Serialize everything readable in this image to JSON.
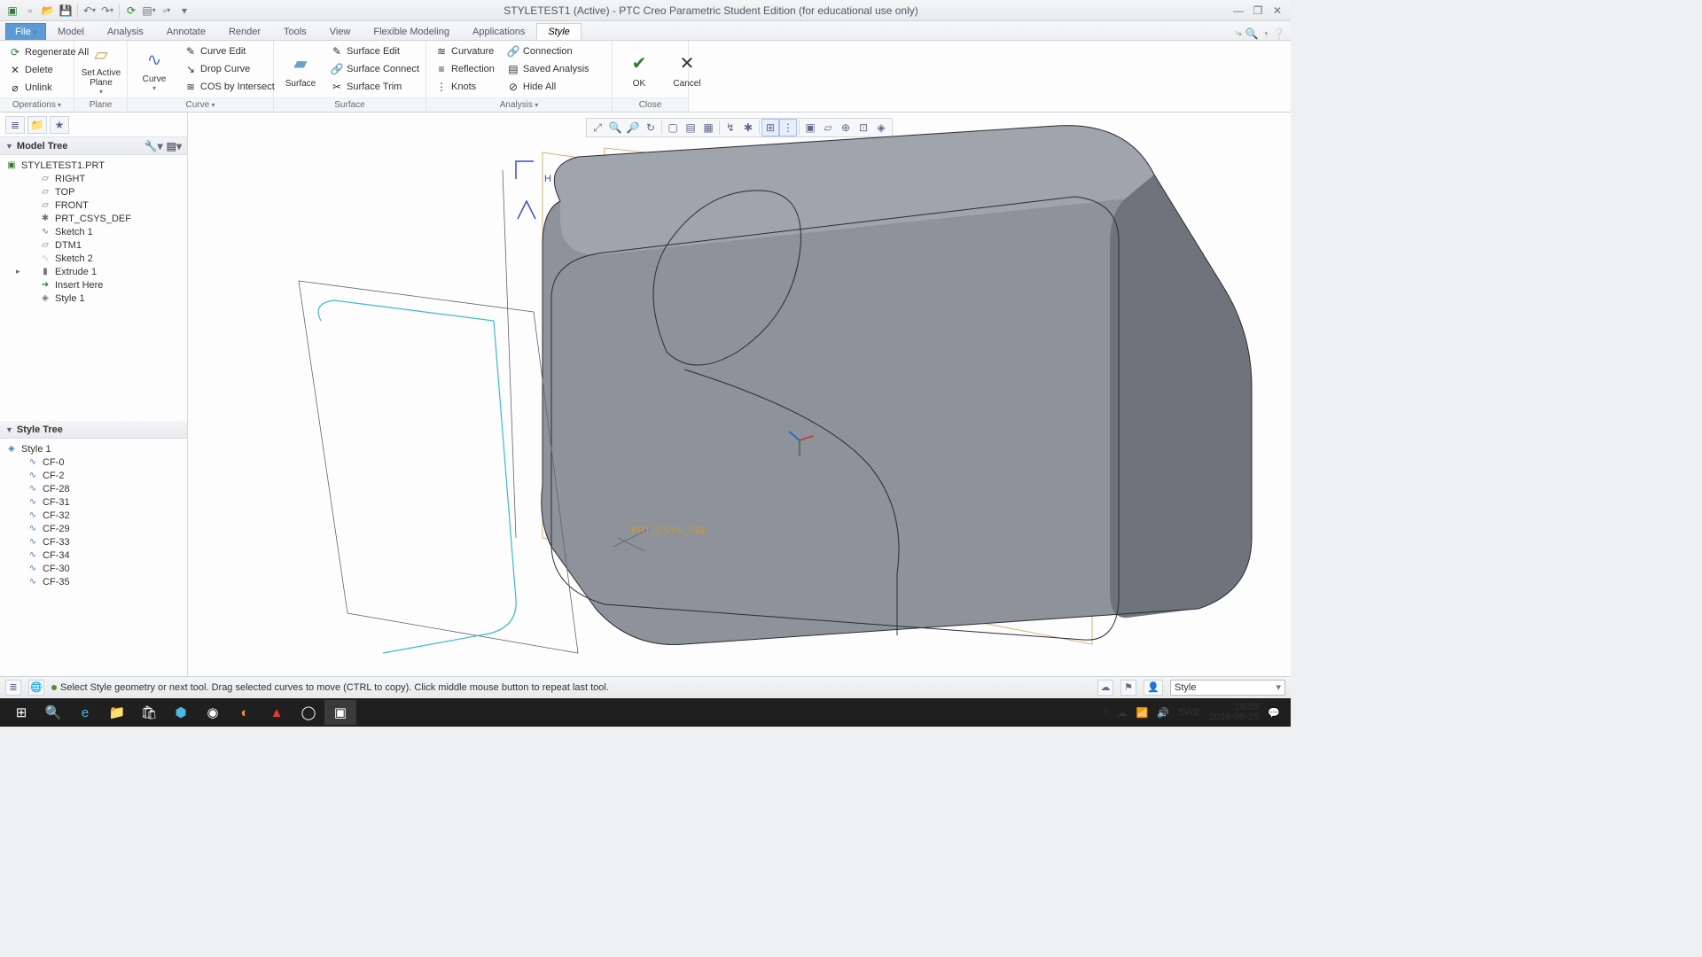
{
  "app_title": "STYLETEST1 (Active) - PTC Creo Parametric Student Edition (for educational use only)",
  "menu": {
    "file": "File"
  },
  "tabs": [
    "Model",
    "Analysis",
    "Annotate",
    "Render",
    "Tools",
    "View",
    "Flexible Modeling",
    "Applications",
    "Style"
  ],
  "active_tab": 8,
  "ribbon": {
    "operations": {
      "regenerate": "Regenerate All",
      "delete": "Delete",
      "unlink": "Unlink",
      "label": "Operations"
    },
    "plane": {
      "set_active": "Set Active\nPlane",
      "label": "Plane"
    },
    "curve": {
      "curve": "Curve",
      "curve_edit": "Curve Edit",
      "drop_curve": "Drop Curve",
      "cos": "COS by Intersect",
      "label": "Curve"
    },
    "surface": {
      "surface": "Surface",
      "surface_edit": "Surface Edit",
      "surface_connect": "Surface Connect",
      "surface_trim": "Surface Trim",
      "label": "Surface"
    },
    "analysis": {
      "curvature": "Curvature",
      "reflection": "Reflection",
      "knots": "Knots",
      "connection": "Connection",
      "saved": "Saved Analysis",
      "hide_all": "Hide All",
      "label": "Analysis"
    },
    "close": {
      "ok": "OK",
      "cancel": "Cancel",
      "label": "Close"
    }
  },
  "model_tree": {
    "header": "Model Tree",
    "root": "STYLETEST1.PRT",
    "items": [
      {
        "label": "RIGHT",
        "icon": "▱"
      },
      {
        "label": "TOP",
        "icon": "▱"
      },
      {
        "label": "FRONT",
        "icon": "▱"
      },
      {
        "label": "PRT_CSYS_DEF",
        "icon": "✱"
      },
      {
        "label": "Sketch 1",
        "icon": "∿"
      },
      {
        "label": "DTM1",
        "icon": "▱"
      },
      {
        "label": "Sketch 2",
        "icon": "∿",
        "dim": true
      },
      {
        "label": "Extrude 1",
        "icon": "▮",
        "exp": "▸"
      },
      {
        "label": "Insert Here",
        "icon": "➔",
        "green": true
      },
      {
        "label": "Style 1",
        "icon": "◈"
      }
    ]
  },
  "style_tree": {
    "header": "Style Tree",
    "root": "Style 1",
    "items": [
      "CF-0",
      "CF-2",
      "CF-28",
      "CF-31",
      "CF-32",
      "CF-29",
      "CF-33",
      "CF-34",
      "CF-30",
      "CF-35"
    ]
  },
  "status": {
    "msg": "Select Style geometry or next tool. Drag selected curves to move (CTRL to copy). Click middle mouse button to repeat last tool.",
    "filter": "Style"
  },
  "csys_label": "PRT_CSYS_DEF",
  "viewport_text": "H",
  "taskbar": {
    "time": "18:59",
    "date": "2016-09-25",
    "lang": "SWE"
  }
}
